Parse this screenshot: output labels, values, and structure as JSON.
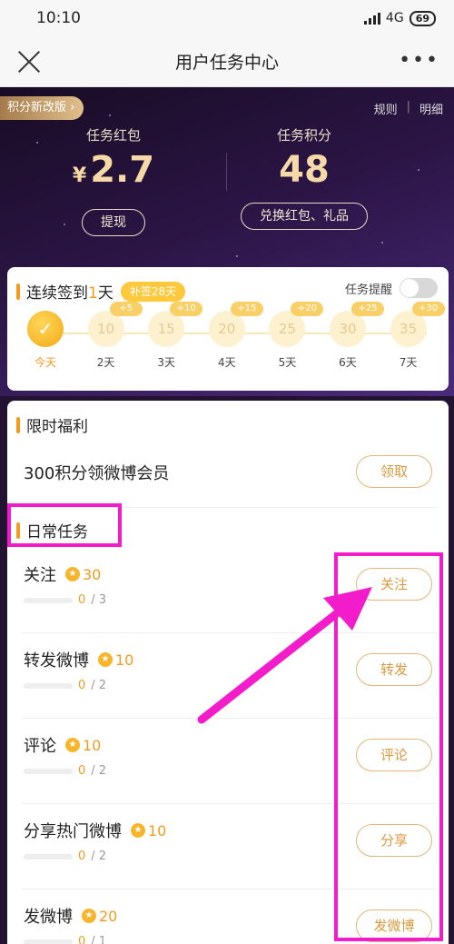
{
  "status": {
    "time": "10:10",
    "network": "4G",
    "battery": "69"
  },
  "nav": {
    "title": "用户任务中心"
  },
  "hero": {
    "badge": "积分新改版 ›",
    "link_rules": "规则",
    "link_sep": "|",
    "link_details": "明细",
    "redpacket_label": "任务红包",
    "redpacket_currency": "¥",
    "redpacket_value": "2.7",
    "withdraw": "提现",
    "points_label": "任务积分",
    "points_value": "48",
    "exchange": "兑换红包、礼品"
  },
  "signin": {
    "title_prefix": "连续签到",
    "title_days": "1",
    "title_suffix": "天",
    "makeup": "补签28天",
    "reminder": "任务提醒",
    "days": [
      {
        "label": "今天",
        "value": "✓",
        "bonus": ""
      },
      {
        "label": "2天",
        "value": "10",
        "bonus": "+5"
      },
      {
        "label": "3天",
        "value": "15",
        "bonus": "+10"
      },
      {
        "label": "4天",
        "value": "20",
        "bonus": "+15"
      },
      {
        "label": "5天",
        "value": "25",
        "bonus": "+20"
      },
      {
        "label": "6天",
        "value": "30",
        "bonus": "+25"
      },
      {
        "label": "7天",
        "value": "35",
        "bonus": "+30"
      }
    ]
  },
  "limited": {
    "title": "限时福利",
    "item": "300积分领微博会员",
    "button": "领取"
  },
  "daily": {
    "title": "日常任务",
    "tasks": [
      {
        "name": "关注",
        "points": "30",
        "done": "0",
        "total": "/ 3",
        "button": "关注"
      },
      {
        "name": "转发微博",
        "points": "10",
        "done": "0",
        "total": "/ 2",
        "button": "转发"
      },
      {
        "name": "评论",
        "points": "10",
        "done": "0",
        "total": "/ 2",
        "button": "评论"
      },
      {
        "name": "分享热门微博",
        "points": "10",
        "done": "0",
        "total": "/ 2",
        "button": "分享"
      },
      {
        "name": "发微博",
        "points": "20",
        "done": "0",
        "total": "/ 1",
        "button": "发微博"
      }
    ]
  },
  "icons": {
    "coin_icon": "star-coin-icon",
    "close_icon": "close-icon",
    "more_icon": "more-dots-icon"
  },
  "colors": {
    "accent": "#f39b1e",
    "highlight": "#f21ccb",
    "hero_bg": "#2b1545"
  }
}
